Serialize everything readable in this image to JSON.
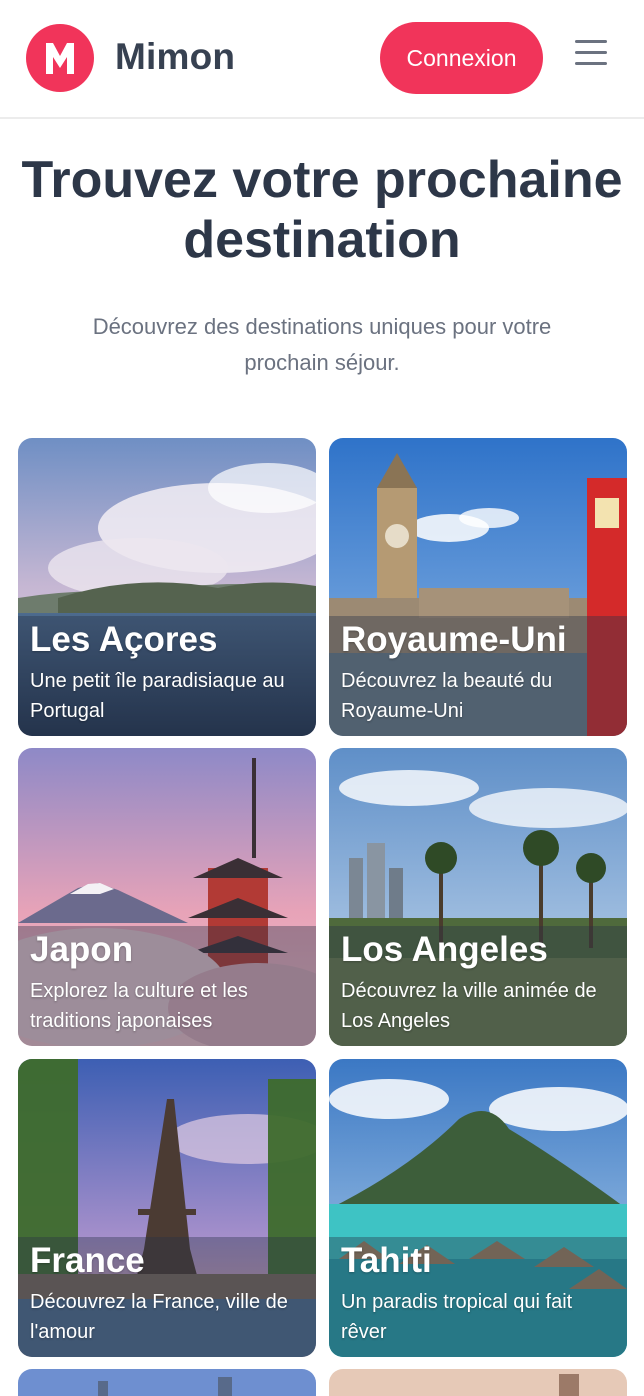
{
  "header": {
    "logo_letter": "M",
    "brand": "Mimon",
    "login_label": "Connexion",
    "accent": "#f1345a"
  },
  "hero": {
    "title": "Trouvez votre prochaine destination",
    "subtitle": "Découvrez des destinations uniques pour votre prochain séjour."
  },
  "destinations": [
    {
      "title": "Les Açores",
      "description": "Une petit île paradisiaque au Portugal"
    },
    {
      "title": "Royaume-Uni",
      "description": "Découvrez la beauté du Royaume-Uni"
    },
    {
      "title": "Japon",
      "description": "Explorez la culture et les traditions japonaises"
    },
    {
      "title": "Los Angeles",
      "description": "Découvrez la ville animée de Los Angeles"
    },
    {
      "title": "France",
      "description": "Découvrez la France, ville de l'amour"
    },
    {
      "title": "Tahiti",
      "description": "Un paradis tropical qui fait rêver"
    }
  ],
  "icons": {
    "menu": "hamburger-menu-icon",
    "logo": "mimon-logo"
  }
}
